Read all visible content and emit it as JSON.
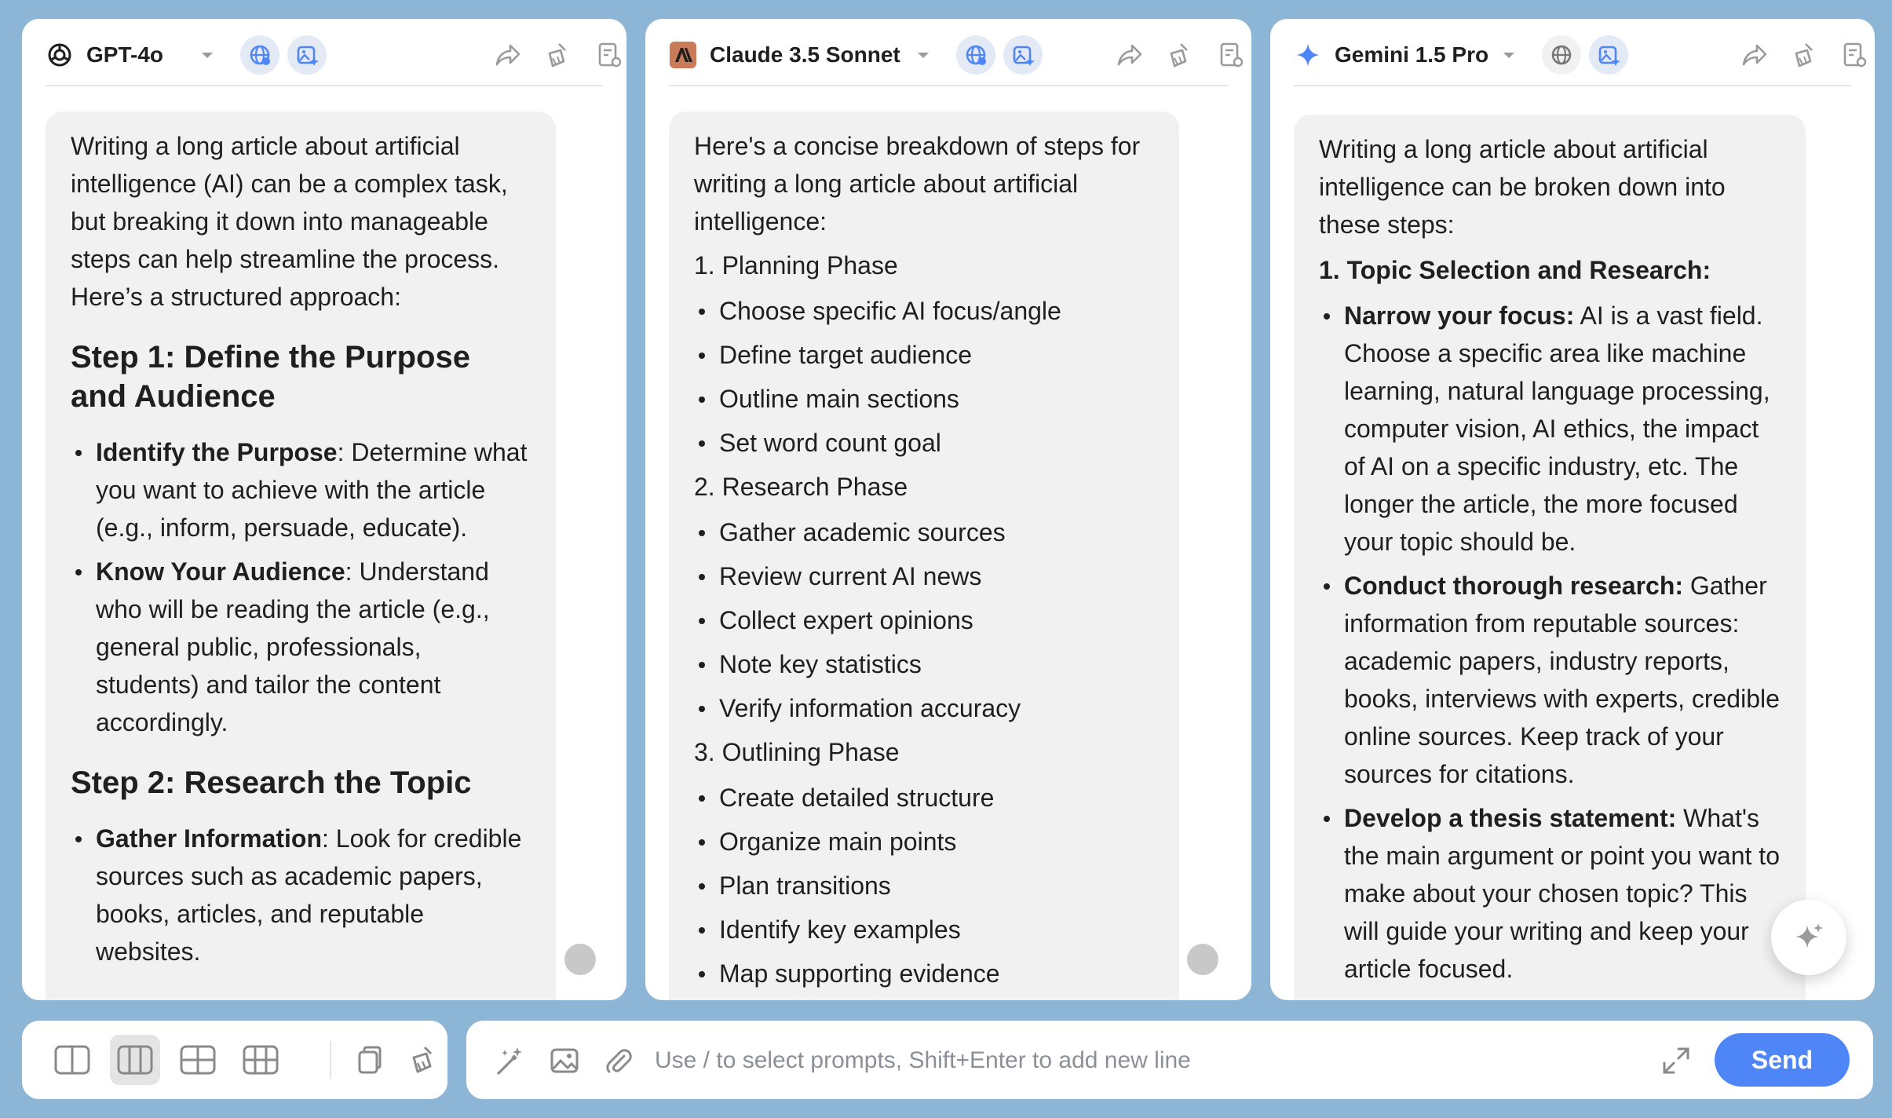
{
  "colors": {
    "background": "#8db5d5",
    "panel": "#ffffff",
    "bubble": "#f1f1f1",
    "accent": "#4f86f7",
    "icon_gray": "#9a9a9a"
  },
  "panels": [
    {
      "model": "GPT-4o",
      "icon": "openai-logo-icon",
      "message": {
        "intro": "Writing a long article about artificial intelligence (AI) can be a complex task, but breaking it down into manageable steps can help streamline the process. Here’s a structured approach:",
        "step1_heading": "Step 1: Define the Purpose and Audience",
        "step1_items": [
          {
            "bold": "Identify the Purpose",
            "text": ": Determine what you want to achieve with the article (e.g., inform, persuade, educate)."
          },
          {
            "bold": "Know Your Audience",
            "text": ": Understand who will be reading the article (e.g., general public, professionals, students) and tailor the content accordingly."
          }
        ],
        "step2_heading": "Step 2: Research the Topic",
        "step2_items": [
          {
            "bold": "Gather Information",
            "text": ": Look for credible sources such as academic papers, books, articles, and reputable websites."
          }
        ]
      }
    },
    {
      "model": "Claude 3.5 Sonnet",
      "icon": "anthropic-logo-icon",
      "message": {
        "intro": "Here's a concise breakdown of steps for writing a long article about artificial intelligence:",
        "phase1": "1. Planning Phase",
        "phase1_items": [
          "Choose specific AI focus/angle",
          "Define target audience",
          "Outline main sections",
          "Set word count goal"
        ],
        "phase2": "2. Research Phase",
        "phase2_items": [
          "Gather academic sources",
          "Review current AI news",
          "Collect expert opinions",
          "Note key statistics",
          "Verify information accuracy"
        ],
        "phase3": "3. Outlining Phase",
        "phase3_items": [
          "Create detailed structure",
          "Organize main points",
          "Plan transitions",
          "Identify key examples",
          "Map supporting evidence"
        ]
      }
    },
    {
      "model": "Gemini 1.5 Pro",
      "icon": "gemini-sparkle-icon",
      "message": {
        "intro": "Writing a long article about artificial intelligence can be broken down into these steps:",
        "section1": "1. Topic Selection and Research:",
        "items": [
          {
            "bold": "Narrow your focus:",
            "text": " AI is a vast field. Choose a specific area like machine learning, natural language processing, computer vision, AI ethics, the impact of AI on a specific industry, etc. The longer the article, the more focused your topic should be."
          },
          {
            "bold": "Conduct thorough research:",
            "text": " Gather information from reputable sources: academic papers, industry reports, books, interviews with experts, credible online sources. Keep track of your sources for citations."
          },
          {
            "bold": "Develop a thesis statement:",
            "text": " What's the main argument or point you want to make about your chosen topic? This will guide your writing and keep your article focused."
          }
        ]
      }
    }
  ],
  "layout_options": [
    "two-column-icon",
    "three-column-icon",
    "grid-2x2-icon",
    "grid-3x3-icon"
  ],
  "input": {
    "placeholder": "Use / to select prompts, Shift+Enter to add new line",
    "value": "",
    "send_label": "Send"
  }
}
